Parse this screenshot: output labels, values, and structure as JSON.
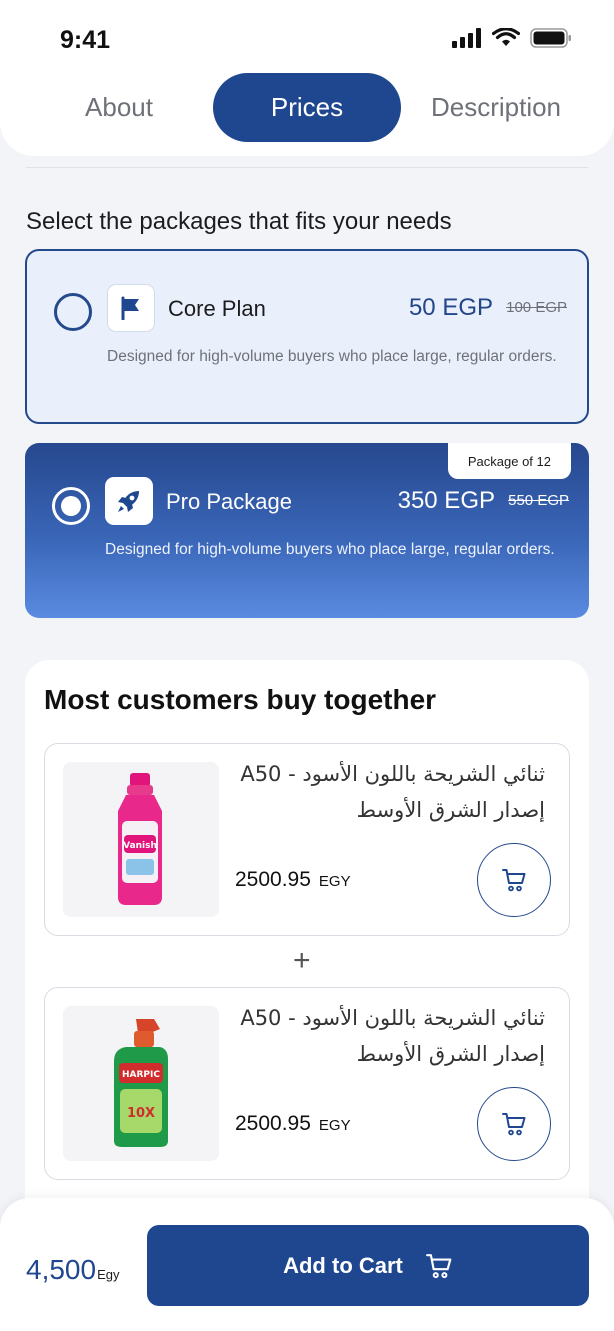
{
  "status_bar": {
    "time": "9:41"
  },
  "tabs": [
    {
      "label": "About",
      "active": false
    },
    {
      "label": "Prices",
      "active": true
    },
    {
      "label": "Description",
      "active": false
    }
  ],
  "section_title": "Select the packages that fits your needs",
  "packages": [
    {
      "name": "Core Plan",
      "icon": "flag-icon",
      "price": "50 EGP",
      "old_price": "100 EGP",
      "description": "Designed for high-volume buyers who place large, regular orders.",
      "selected": false
    },
    {
      "name": "Pro Package",
      "icon": "rocket-icon",
      "price": "350 EGP",
      "old_price": "550 EGP",
      "badge": "Package of 12",
      "description": "Designed for high-volume buyers who place large, regular orders.",
      "selected": true
    }
  ],
  "bundle": {
    "title": "Most customers buy together",
    "separator": "+",
    "products": [
      {
        "name": "ثنائي الشريحة باللون الأسود - A50 إصدار الشرق الأوسط",
        "price": "2500.95",
        "currency": "EGY",
        "image": "pink-detergent-bottle"
      },
      {
        "name": "ثنائي الشريحة باللون الأسود - A50 إصدار الشرق الأوسط",
        "price": "2500.95",
        "currency": "EGY",
        "image": "green-toilet-cleaner-bottle"
      }
    ]
  },
  "footer": {
    "total": "4,500",
    "total_unit": "Egy",
    "add_to_cart_label": "Add to Cart"
  },
  "colors": {
    "primary": "#1f4790",
    "background": "#f2f4f8",
    "core_card_bg": "#e9f0fb"
  }
}
